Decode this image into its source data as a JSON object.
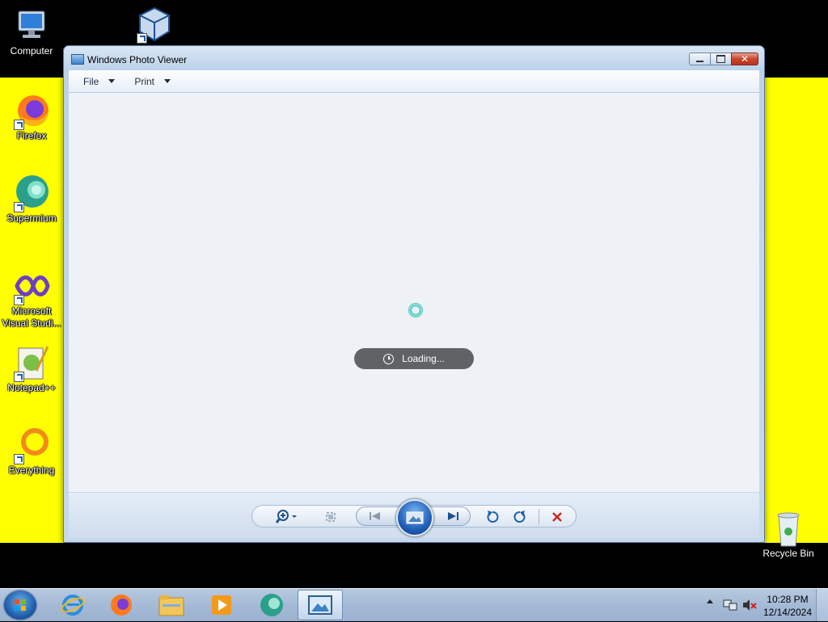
{
  "desktop": {
    "icons": [
      {
        "label": "Computer",
        "icon": "computer-icon"
      },
      {
        "label": "",
        "icon": "virtualbox-icon"
      },
      {
        "label": "Firefox",
        "icon": "firefox-icon"
      },
      {
        "label": "Supermium",
        "icon": "supermium-icon"
      },
      {
        "label": "Microsoft Visual Studi...",
        "icon": "visual-studio-icon"
      },
      {
        "label": "Notepad++",
        "icon": "notepadpp-icon"
      },
      {
        "label": "Everything",
        "icon": "everything-icon"
      },
      {
        "label": "Recycle Bin",
        "icon": "recycle-bin-icon"
      }
    ],
    "band_color": "#ffff00"
  },
  "window": {
    "title": "Windows Photo Viewer",
    "menu": [
      {
        "label": "File"
      },
      {
        "label": "Print"
      }
    ],
    "loading_text": "Loading..."
  },
  "taskbar": {
    "pinned": [
      "internet-explorer-icon",
      "firefox-icon",
      "file-explorer-icon",
      "media-player-icon",
      "supermium-icon",
      "photo-viewer-icon"
    ],
    "clock_time": "10:28 PM",
    "clock_date": "12/14/2024"
  }
}
